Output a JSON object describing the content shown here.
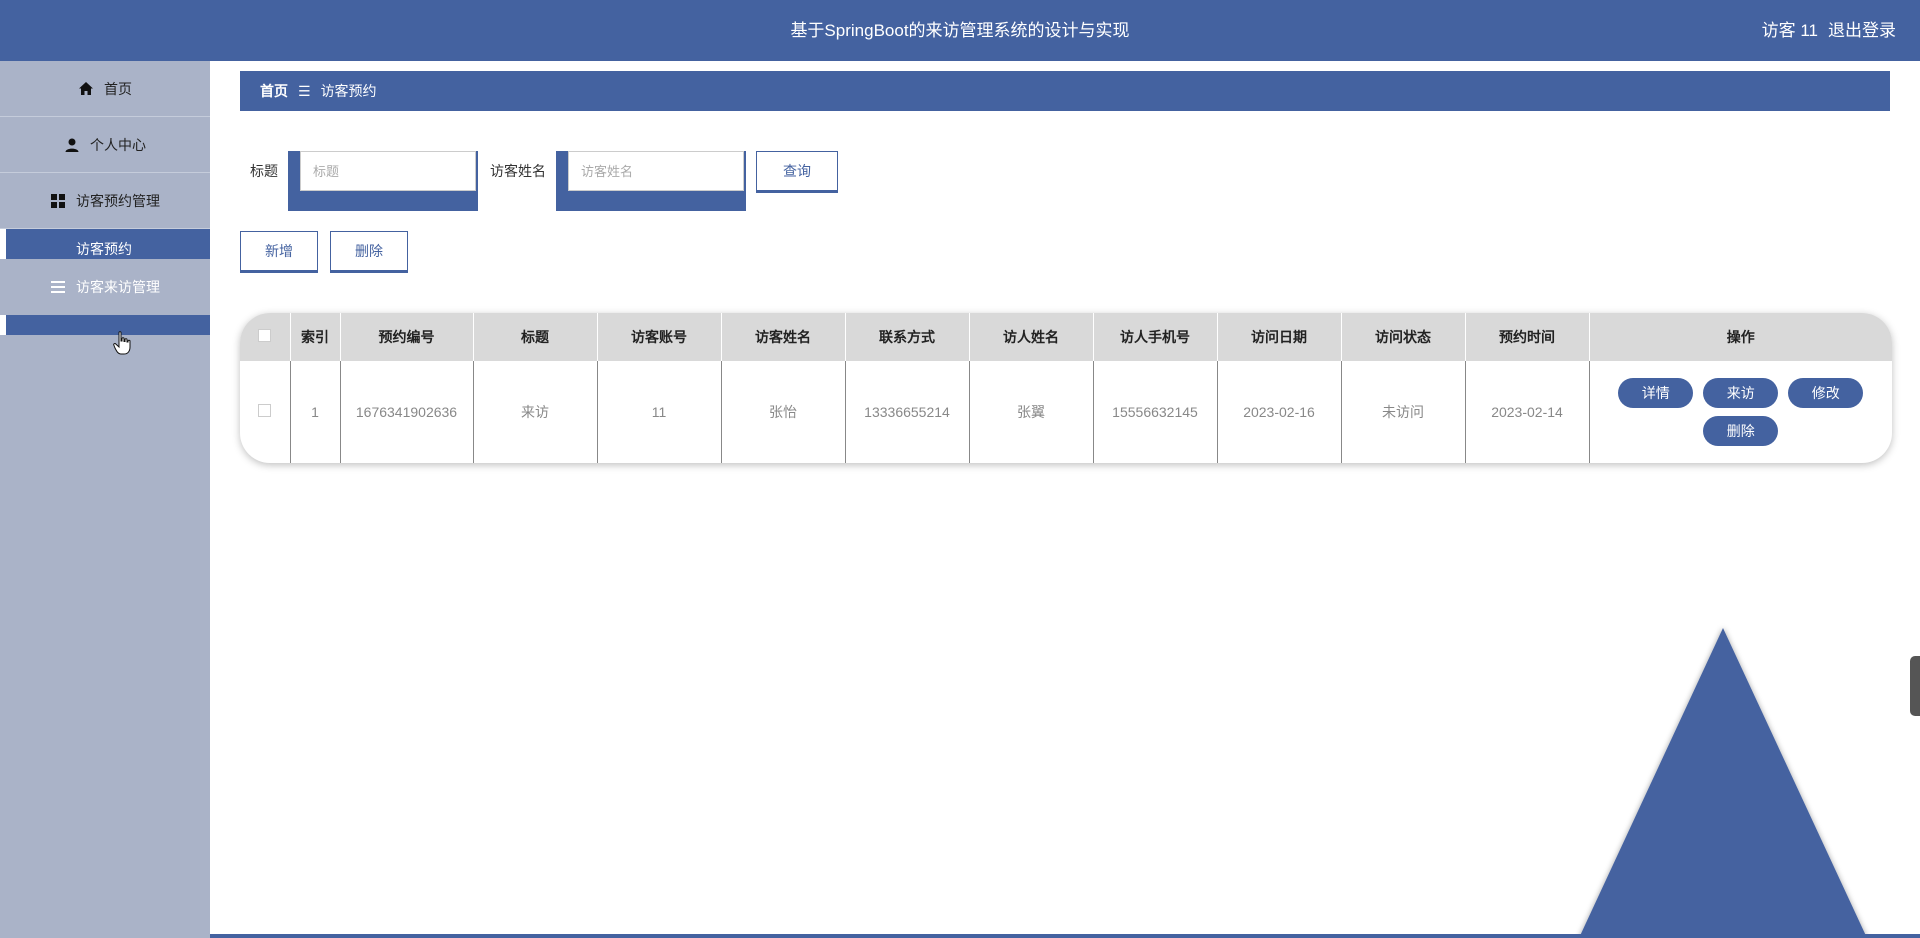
{
  "header": {
    "title": "基于SpringBoot的来访管理系统的设计与实现",
    "user": "访客 11",
    "logout": "退出登录"
  },
  "sidebar": {
    "items": [
      {
        "label": "首页",
        "icon": "home-icon"
      },
      {
        "label": "个人中心",
        "icon": "user-icon"
      },
      {
        "label": "访客预约管理",
        "icon": "grid-icon"
      }
    ],
    "sub_item": "访客预约",
    "overlap_item": {
      "label": "访客来访管理",
      "icon": "list-icon"
    }
  },
  "breadcrumb": {
    "home": "首页",
    "separator": "☰",
    "current": "访客预约"
  },
  "search": {
    "title_label": "标题",
    "title_placeholder": "标题",
    "name_label": "访客姓名",
    "name_placeholder": "访客姓名",
    "query_button": "查询"
  },
  "actions": {
    "add": "新增",
    "delete": "删除"
  },
  "table": {
    "headers": [
      "索引",
      "预约编号",
      "标题",
      "访客账号",
      "访客姓名",
      "联系方式",
      "访人姓名",
      "访人手机号",
      "访问日期",
      "访问状态",
      "预约时间",
      "操作"
    ],
    "rows": [
      {
        "index": "1",
        "booking_no": "1676341902636",
        "title": "来访",
        "account": "11",
        "visitor_name": "张怡",
        "contact": "13336655214",
        "host_name": "张翼",
        "host_phone": "15556632145",
        "visit_date": "2023-02-16",
        "status": "未访问",
        "booking_time": "2023-02-14"
      }
    ],
    "op_buttons": {
      "detail": "详情",
      "visit": "来访",
      "edit": "修改",
      "delete": "删除"
    }
  },
  "colors": {
    "primary": "#4462a0",
    "sidebar_bg": "#aab3c8",
    "table_header_bg": "#d9d9d9"
  }
}
